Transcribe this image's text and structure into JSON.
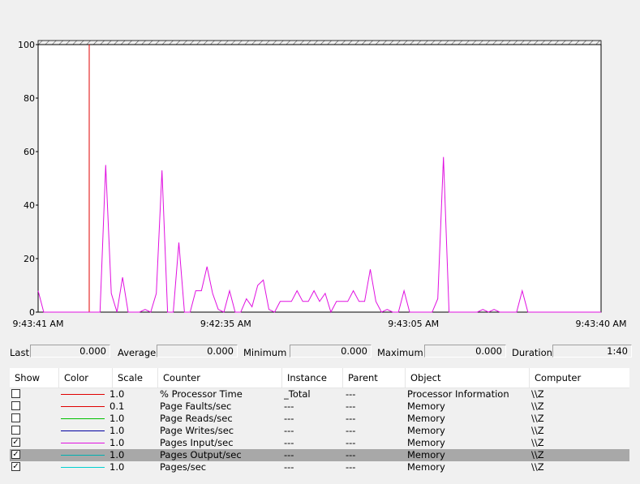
{
  "graph": {
    "y_ticks": [
      "100",
      "80",
      "60",
      "40",
      "20",
      "0"
    ],
    "x_labels": [
      "9:43:41 AM",
      "9:42:35 AM",
      "9:43:05 AM",
      "9:43:40 AM"
    ],
    "time_bar_color": "#e00000",
    "line_color": "#e010e0"
  },
  "chart_data": {
    "type": "line",
    "ylim": [
      0,
      100
    ],
    "grid": false,
    "series": [
      {
        "name": "Pages Input/sec",
        "values": [
          8,
          0,
          0,
          0,
          0,
          0,
          0,
          0,
          0,
          0,
          0,
          0,
          55,
          7,
          0,
          13,
          0,
          0,
          0,
          1,
          0,
          7,
          53,
          0,
          0,
          26,
          0,
          0,
          8,
          8,
          17,
          7,
          1,
          0,
          8,
          0,
          0,
          5,
          2,
          10,
          12,
          1,
          0,
          4,
          4,
          4,
          8,
          4,
          4,
          8,
          4,
          7,
          0,
          4,
          4,
          4,
          8,
          4,
          4,
          16,
          4,
          0,
          1,
          0,
          0,
          8,
          0,
          0,
          0,
          0,
          0,
          5,
          58,
          0,
          0,
          0,
          0,
          0,
          0,
          1,
          0,
          1,
          0,
          0,
          0,
          0,
          8,
          0,
          0,
          0,
          0,
          0,
          0,
          0,
          0,
          0,
          0,
          0,
          0,
          0,
          0
        ]
      }
    ]
  },
  "stats": {
    "last_label": "Last",
    "last_value": "0.000",
    "average_label": "Average",
    "average_value": "0.000",
    "minimum_label": "Minimum",
    "minimum_value": "0.000",
    "maximum_label": "Maximum",
    "maximum_value": "0.000",
    "duration_label": "Duration",
    "duration_value": "1:40"
  },
  "table": {
    "headers": [
      "Show",
      "Color",
      "Scale",
      "Counter",
      "Instance",
      "Parent",
      "Object",
      "Computer"
    ],
    "rows": [
      {
        "show": false,
        "color": "#e00000",
        "scale": "1.0",
        "counter": "% Processor Time",
        "instance": "_Total",
        "parent": "---",
        "object": "Processor Information",
        "computer": "\\\\Z"
      },
      {
        "show": false,
        "color": "#e00000",
        "scale": "0.1",
        "counter": "Page Faults/sec",
        "instance": "---",
        "parent": "---",
        "object": "Memory",
        "computer": "\\\\Z"
      },
      {
        "show": false,
        "color": "#00c000",
        "scale": "1.0",
        "counter": "Page Reads/sec",
        "instance": "---",
        "parent": "---",
        "object": "Memory",
        "computer": "\\\\Z"
      },
      {
        "show": false,
        "color": "#0000a0",
        "scale": "1.0",
        "counter": "Page Writes/sec",
        "instance": "---",
        "parent": "---",
        "object": "Memory",
        "computer": "\\\\Z"
      },
      {
        "show": true,
        "color": "#e010e0",
        "scale": "1.0",
        "counter": "Pages Input/sec",
        "instance": "---",
        "parent": "---",
        "object": "Memory",
        "computer": "\\\\Z"
      },
      {
        "show": true,
        "color": "#00b0b0",
        "scale": "1.0",
        "counter": "Pages Output/sec",
        "instance": "---",
        "parent": "---",
        "object": "Memory",
        "computer": "\\\\Z",
        "selected": true
      },
      {
        "show": true,
        "color": "#00d0d0",
        "scale": "1.0",
        "counter": "Pages/sec",
        "instance": "---",
        "parent": "---",
        "object": "Memory",
        "computer": "\\\\Z"
      }
    ]
  }
}
